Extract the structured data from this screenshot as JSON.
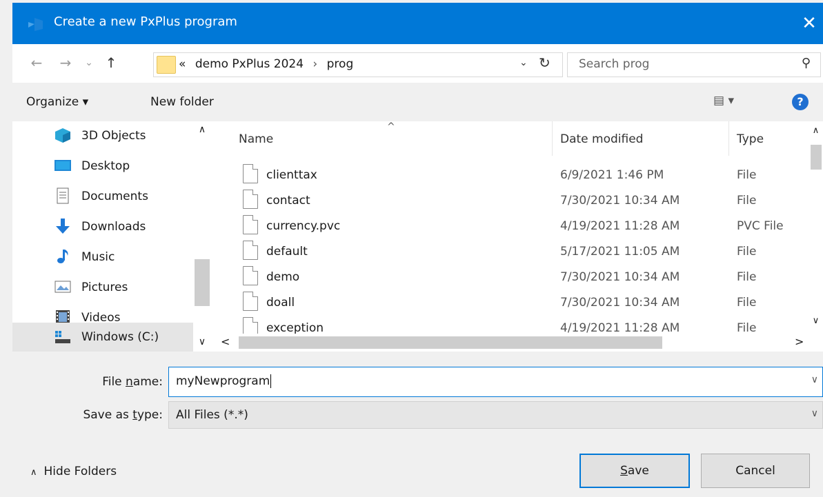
{
  "window": {
    "title": "Create a new PxPlus program",
    "close_glyph": "✕"
  },
  "nav": {
    "back_glyph": "←",
    "forward_glyph": "→",
    "recent_glyph": "⌄",
    "up_glyph": "↑",
    "address": {
      "overflow": "«",
      "crumbs": [
        "demo PxPlus 2024",
        "prog"
      ],
      "separator": "›"
    },
    "search_placeholder": "Search prog"
  },
  "toolbar": {
    "organize_label": "Organize ▾",
    "new_folder_label": "New folder",
    "view_label": "▤ ▾",
    "help_glyph": "?"
  },
  "sidebar": {
    "items": [
      {
        "label": "3D Objects",
        "icon": "3d-objects-icon",
        "color": "#2aa7d8"
      },
      {
        "label": "Desktop",
        "icon": "desktop-icon",
        "color": "#1e88d6"
      },
      {
        "label": "Documents",
        "icon": "documents-icon",
        "color": "#6c6c6c"
      },
      {
        "label": "Downloads",
        "icon": "downloads-icon",
        "color": "#1e78d6"
      },
      {
        "label": "Music",
        "icon": "music-icon",
        "color": "#1e78d6"
      },
      {
        "label": "Pictures",
        "icon": "pictures-icon",
        "color": "#6c6c6c"
      },
      {
        "label": "Videos",
        "icon": "videos-icon",
        "color": "#444444"
      },
      {
        "label": "Windows (C:)",
        "icon": "drive-icon",
        "color": "#444444"
      }
    ],
    "selected_index": 7
  },
  "file_list": {
    "columns": {
      "name": "Name",
      "date": "Date modified",
      "type": "Type"
    },
    "rows": [
      {
        "name": "clienttax",
        "date": "6/9/2021 1:46 PM",
        "type": "File"
      },
      {
        "name": "contact",
        "date": "7/30/2021 10:34 AM",
        "type": "File"
      },
      {
        "name": "currency.pvc",
        "date": "4/19/2021 11:28 AM",
        "type": "PVC File"
      },
      {
        "name": "default",
        "date": "5/17/2021 11:05 AM",
        "type": "File"
      },
      {
        "name": "demo",
        "date": "7/30/2021 10:34 AM",
        "type": "File"
      },
      {
        "name": "doall",
        "date": "7/30/2021 10:34 AM",
        "type": "File"
      },
      {
        "name": "exception",
        "date": "4/19/2021 11:28 AM",
        "type": "File"
      }
    ]
  },
  "form": {
    "file_name_label_pre": "File ",
    "file_name_label_u": "n",
    "file_name_label_post": "ame:",
    "file_name_value": "myNewprogram",
    "save_type_label_pre": "Save as ",
    "save_type_label_u": "t",
    "save_type_label_post": "ype:",
    "save_type_value": "All Files (*.*)"
  },
  "footer": {
    "hide_folders_label": "Hide Folders",
    "save_label_u": "S",
    "save_label_rest": "ave",
    "cancel_label": "Cancel"
  },
  "colors": {
    "titlebar": "#0078d7",
    "accent": "#0078d7"
  }
}
